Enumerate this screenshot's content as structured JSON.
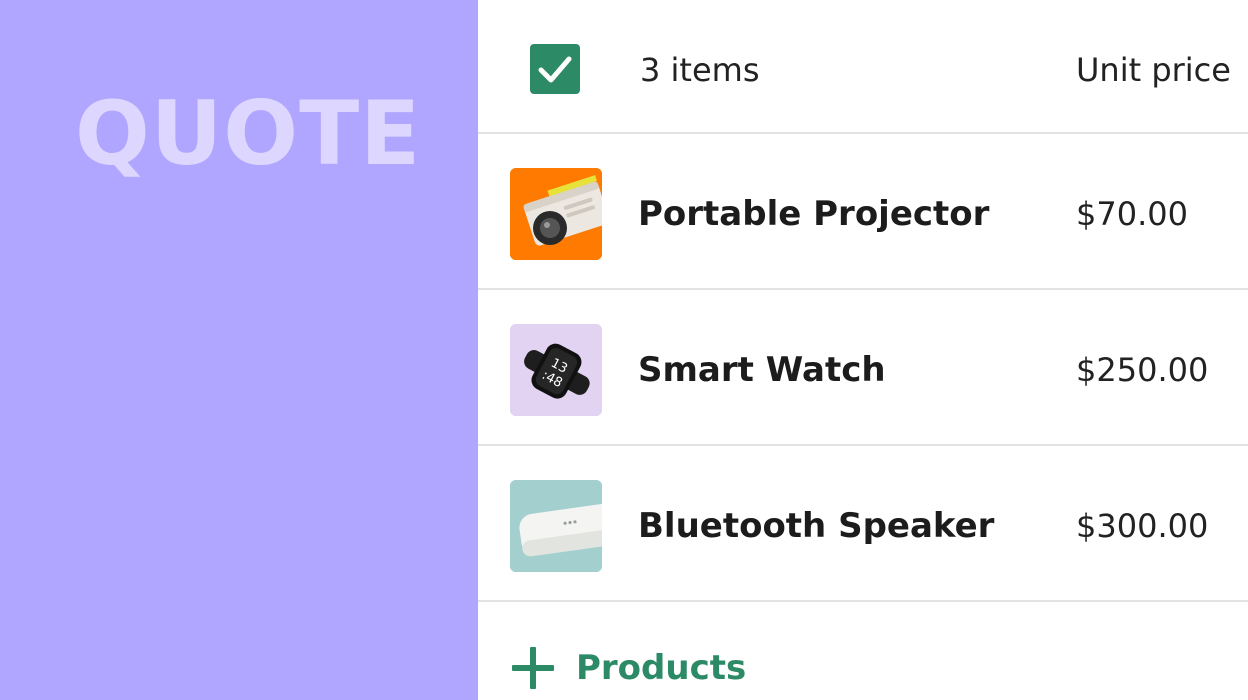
{
  "left_panel": {
    "title": "QUOTE",
    "background": "#b0a6ff",
    "title_color": "#ddd7ff"
  },
  "table": {
    "select_all_checked": true,
    "items_count_label": "3 items",
    "unit_price_header": "Unit price",
    "rows": [
      {
        "name": "Portable Projector",
        "price": "$70.00",
        "thumb_icon": "projector-icon",
        "thumb_bg": "#ff7a00"
      },
      {
        "name": "Smart Watch",
        "price": "$250.00",
        "thumb_icon": "smart-watch-icon",
        "thumb_bg": "#e2d3f3"
      },
      {
        "name": "Bluetooth Speaker",
        "price": "$300.00",
        "thumb_icon": "bluetooth-speaker-icon",
        "thumb_bg": "#a3cfcf"
      }
    ]
  },
  "add_products": {
    "icon": "plus-icon",
    "label": "Products"
  },
  "colors": {
    "accent": "#2c8a66",
    "divider": "#e3e3e3"
  },
  "watch_display": {
    "line1": "13",
    "line2": ":48"
  }
}
